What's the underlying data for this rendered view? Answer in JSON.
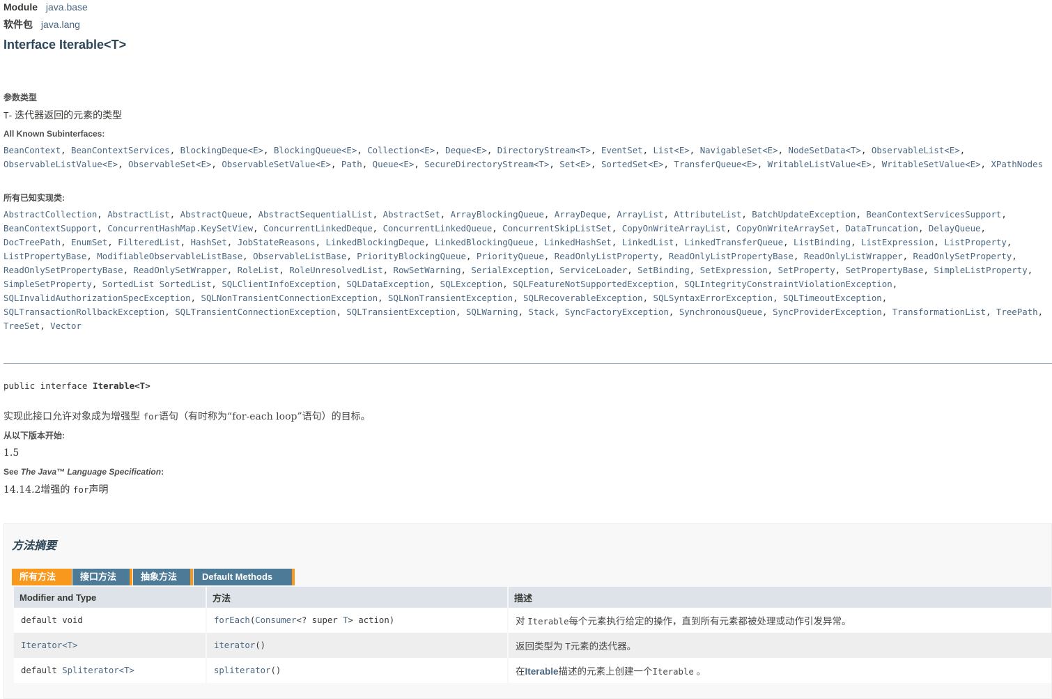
{
  "header": {
    "module_label": "Module",
    "module_value": "java.base",
    "package_label": "软件包",
    "package_value": "java.lang",
    "title": "Interface Iterable<T>"
  },
  "type_params": {
    "heading": "参数类型",
    "param_name": "T",
    "param_desc": "- 迭代器返回的元素的类型"
  },
  "subinterfaces": {
    "heading": "All Known Subinterfaces:",
    "items": [
      "BeanContext",
      "BeanContextServices",
      "BlockingDeque<E>",
      "BlockingQueue<E>",
      "Collection<E>",
      "Deque<E>",
      "DirectoryStream<T>",
      "EventSet",
      "List<E>",
      "NavigableSet<E>",
      "NodeSetData<T>",
      "ObservableList<E>",
      "ObservableListValue<E>",
      "ObservableSet<E>",
      "ObservableSetValue<E>",
      "Path",
      "Queue<E>",
      "SecureDirectoryStream<T>",
      "Set<E>",
      "SortedSet<E>",
      "TransferQueue<E>",
      "WritableListValue<E>",
      "WritableSetValue<E>",
      "XPathNodes"
    ]
  },
  "implementing": {
    "heading": "所有已知实现类:",
    "items": [
      "AbstractCollection",
      "AbstractList",
      "AbstractQueue",
      "AbstractSequentialList",
      "AbstractSet",
      "ArrayBlockingQueue",
      "ArrayDeque",
      "ArrayList",
      "AttributeList",
      "BatchUpdateException",
      "BeanContextServicesSupport",
      "BeanContextSupport",
      "ConcurrentHashMap.KeySetView",
      "ConcurrentLinkedDeque",
      "ConcurrentLinkedQueue",
      "ConcurrentSkipListSet",
      "CopyOnWriteArrayList",
      "CopyOnWriteArraySet",
      "DataTruncation",
      "DelayQueue",
      "DocTreePath",
      "EnumSet",
      "FilteredList",
      "HashSet",
      "JobStateReasons",
      "LinkedBlockingDeque",
      "LinkedBlockingQueue",
      "LinkedHashSet",
      "LinkedList",
      "LinkedTransferQueue",
      "ListBinding",
      "ListExpression",
      "ListProperty",
      "ListPropertyBase",
      "ModifiableObservableListBase",
      "ObservableListBase",
      "PriorityBlockingQueue",
      "PriorityQueue",
      "ReadOnlyListProperty",
      "ReadOnlyListPropertyBase",
      "ReadOnlyListWrapper",
      "ReadOnlySetProperty",
      "ReadOnlySetPropertyBase",
      "ReadOnlySetWrapper",
      "RoleList",
      "RoleUnresolvedList",
      "RowSetWarning",
      "SerialException",
      "ServiceLoader",
      "SetBinding",
      "SetExpression",
      "SetProperty",
      "SetPropertyBase",
      "SimpleListProperty",
      "SimpleSetProperty",
      "SortedList SortedList",
      "SQLClientInfoException",
      "SQLDataException",
      "SQLException",
      "SQLFeatureNotSupportedException",
      "SQLIntegrityConstraintViolationException",
      "SQLInvalidAuthorizationSpecException",
      "SQLNonTransientConnectionException",
      "SQLNonTransientException",
      "SQLRecoverableException",
      "SQLSyntaxErrorException",
      "SQLTimeoutException",
      "SQLTransactionRollbackException",
      "SQLTransientConnectionException",
      "SQLTransientException",
      "SQLWarning",
      "Stack",
      "SyncFactoryException",
      "SynchronousQueue",
      "SyncProviderException",
      "TransformationList",
      "TreePath",
      "TreeSet",
      "Vector"
    ]
  },
  "signature": {
    "prefix": "public interface ",
    "name": "Iterable<T>"
  },
  "description": {
    "pre": "实现此接口允许对象成为增强型 ",
    "code": "for",
    "post": "语句（有时称为“for-each loop”语句）的目标。"
  },
  "since": {
    "heading": "从以下版本开始:",
    "value": "1.5"
  },
  "see": {
    "heading_prefix": "See ",
    "heading_title": "The Java™ Language Specification",
    "heading_suffix": ":",
    "link_pre": "14.14.2增强的 ",
    "link_code": "for",
    "link_post": "声明"
  },
  "summary": {
    "title": "方法摘要",
    "tabs": [
      "所有方法",
      "接口方法",
      "抽象方法",
      "Default Methods"
    ],
    "columns": [
      "Modifier and Type",
      "方法",
      "描述"
    ],
    "rows": [
      {
        "mod_plain": "default void",
        "mod_link": "",
        "method": "forEach",
        "params": "(Consumer<? super T> action)",
        "params_link": "Consumer",
        "desc_pre": "对 ",
        "desc_code": "Iterable",
        "desc_post": "每个元素执行给定的操作，直到所有元素都被处理或动作引发异常。"
      },
      {
        "mod_plain": "",
        "mod_link": "Iterator<T>",
        "method": "iterator",
        "params": "()",
        "params_link": "",
        "desc_pre": "返回类型为 ",
        "desc_code": "T",
        "desc_post": "元素的迭代器。"
      },
      {
        "mod_plain": "default ",
        "mod_link": "Spliterator<T>",
        "method": "spliterator",
        "params": "()",
        "params_link": "",
        "desc_pre": "在",
        "desc_code": "Iterable",
        "desc_post": "描述的元素上创建一个Iterable 。"
      }
    ]
  },
  "colors": {
    "link": "#4A6782",
    "tab_active": "#F8981D",
    "tab_inactive": "#4D7A97",
    "table_header": "#dee3e9"
  }
}
